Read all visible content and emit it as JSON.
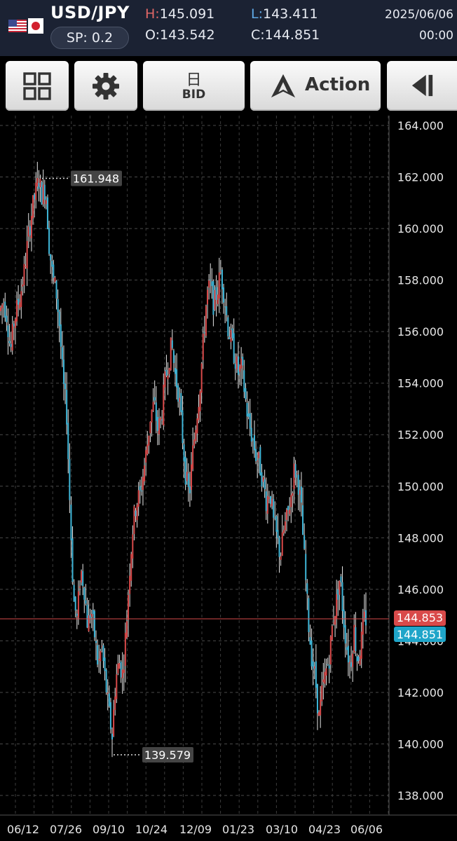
{
  "header": {
    "symbol": "USD/JPY",
    "spread": "SP: 0.2",
    "high_key": "H:",
    "high": "145.091",
    "low_key": "L:",
    "low": "143.411",
    "open_key": "O:",
    "open": "143.542",
    "close_key": "C:",
    "close": "144.851",
    "date": "2025/06/06",
    "time": "00:00"
  },
  "toolbar": {
    "layout_icon": "grid-icon",
    "settings_icon": "gear-icon",
    "period_label": "日",
    "price_type_label": "BID",
    "action_label": "Action",
    "collapse_icon": "collapse-left-icon"
  },
  "colors": {
    "header_bg": "#1b2233",
    "up": "#d94a4a",
    "down": "#3fb6d8",
    "ask_tag": "#d94a4a",
    "bid_tag": "#1fa5c9",
    "current_line": "#d94a4a"
  },
  "chart_data": {
    "type": "candlestick",
    "period": "daily",
    "y_ticks": [
      "164.000",
      "162.000",
      "160.000",
      "158.000",
      "156.000",
      "154.000",
      "152.000",
      "150.000",
      "148.000",
      "146.000",
      "144.000",
      "142.000",
      "140.000",
      "138.000"
    ],
    "ylim": [
      137.3,
      165.0
    ],
    "x_ticks": [
      "06/12",
      "07/26",
      "09/10",
      "10/24",
      "12/09",
      "01/23",
      "03/10",
      "04/23",
      "06/06"
    ],
    "grid": true,
    "max_marker": "161.948",
    "min_marker": "139.579",
    "ask_price": "144.853",
    "bid_price": "144.851",
    "approx_path": [
      [
        0,
        156.8
      ],
      [
        5,
        157.2
      ],
      [
        10,
        156.6
      ],
      [
        15,
        155.2
      ],
      [
        20,
        156.4
      ],
      [
        25,
        157.0
      ],
      [
        30,
        157.6
      ],
      [
        35,
        158.4
      ],
      [
        40,
        159.6
      ],
      [
        45,
        160.6
      ],
      [
        50,
        161.3
      ],
      [
        55,
        161.9
      ],
      [
        60,
        161.3
      ],
      [
        65,
        161.6
      ],
      [
        70,
        159.4
      ],
      [
        75,
        158.1
      ],
      [
        80,
        157.6
      ],
      [
        85,
        156.2
      ],
      [
        90,
        154.0
      ],
      [
        95,
        152.9
      ],
      [
        100,
        149.0
      ],
      [
        105,
        145.6
      ],
      [
        110,
        144.8
      ],
      [
        115,
        146.8
      ],
      [
        120,
        146.1
      ],
      [
        125,
        144.6
      ],
      [
        130,
        145.2
      ],
      [
        135,
        144.2
      ],
      [
        140,
        143.0
      ],
      [
        145,
        143.8
      ],
      [
        150,
        142.5
      ],
      [
        155,
        141.3
      ],
      [
        160,
        140.3
      ],
      [
        165,
        142.5
      ],
      [
        170,
        143.2
      ],
      [
        175,
        142.7
      ],
      [
        180,
        144.5
      ],
      [
        185,
        146.8
      ],
      [
        190,
        148.6
      ],
      [
        195,
        149.4
      ],
      [
        200,
        149.7
      ],
      [
        205,
        150.6
      ],
      [
        210,
        151.6
      ],
      [
        215,
        152.8
      ],
      [
        220,
        153.2
      ],
      [
        225,
        152.2
      ],
      [
        230,
        152.6
      ],
      [
        235,
        154.0
      ],
      [
        240,
        154.8
      ],
      [
        245,
        155.5
      ],
      [
        250,
        154.3
      ],
      [
        255,
        153.6
      ],
      [
        260,
        152.0
      ],
      [
        265,
        150.4
      ],
      [
        270,
        149.6
      ],
      [
        275,
        151.3
      ],
      [
        280,
        152.6
      ],
      [
        285,
        153.8
      ],
      [
        290,
        155.6
      ],
      [
        295,
        157.4
      ],
      [
        300,
        157.8
      ],
      [
        305,
        157.0
      ],
      [
        310,
        157.6
      ],
      [
        315,
        158.3
      ],
      [
        320,
        157.4
      ],
      [
        325,
        156.2
      ],
      [
        330,
        155.6
      ],
      [
        335,
        155.0
      ],
      [
        340,
        154.4
      ],
      [
        345,
        154.6
      ],
      [
        350,
        153.4
      ],
      [
        355,
        152.4
      ],
      [
        360,
        151.9
      ],
      [
        365,
        151.2
      ],
      [
        370,
        150.9
      ],
      [
        375,
        150.2
      ],
      [
        380,
        149.4
      ],
      [
        385,
        149.9
      ],
      [
        390,
        148.6
      ],
      [
        395,
        148.0
      ],
      [
        400,
        147.3
      ],
      [
        405,
        148.3
      ],
      [
        410,
        148.8
      ],
      [
        415,
        149.6
      ],
      [
        420,
        150.7
      ],
      [
        425,
        150.3
      ],
      [
        430,
        149.0
      ],
      [
        435,
        146.8
      ],
      [
        440,
        144.7
      ],
      [
        445,
        143.3
      ],
      [
        450,
        142.5
      ],
      [
        455,
        141.0
      ],
      [
        460,
        142.1
      ],
      [
        465,
        142.8
      ],
      [
        470,
        143.4
      ],
      [
        475,
        144.8
      ],
      [
        480,
        145.5
      ],
      [
        485,
        146.5
      ],
      [
        490,
        144.9
      ],
      [
        495,
        143.7
      ],
      [
        500,
        143.0
      ],
      [
        505,
        144.5
      ],
      [
        510,
        143.2
      ],
      [
        515,
        143.9
      ],
      [
        520,
        144.85
      ]
    ]
  }
}
